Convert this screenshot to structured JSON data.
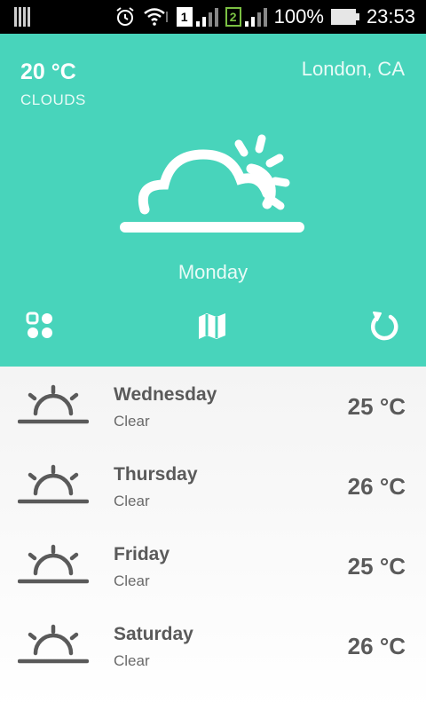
{
  "status_bar": {
    "sim1": "1",
    "sim2": "2",
    "battery": "100%",
    "time": "23:53"
  },
  "current": {
    "temp": "20 °C",
    "condition": "CLOUDS",
    "location": "London, CA",
    "day": "Monday",
    "icon": "cloud-sun-icon"
  },
  "actions": [
    {
      "name": "apps-grid-icon"
    },
    {
      "name": "map-icon"
    },
    {
      "name": "refresh-icon"
    }
  ],
  "forecast": [
    {
      "day": "Wednesday",
      "condition": "Clear",
      "temp": "25 °C",
      "icon": "sunrise-icon"
    },
    {
      "day": "Thursday",
      "condition": "Clear",
      "temp": "26 °C",
      "icon": "sunrise-icon"
    },
    {
      "day": "Friday",
      "condition": "Clear",
      "temp": "25 °C",
      "icon": "sunrise-icon"
    },
    {
      "day": "Saturday",
      "condition": "Clear",
      "temp": "26 °C",
      "icon": "sunrise-icon"
    }
  ],
  "colors": {
    "accent": "#48d4bb",
    "status_bar": "#000000",
    "list_text": "#5a5a5a"
  }
}
